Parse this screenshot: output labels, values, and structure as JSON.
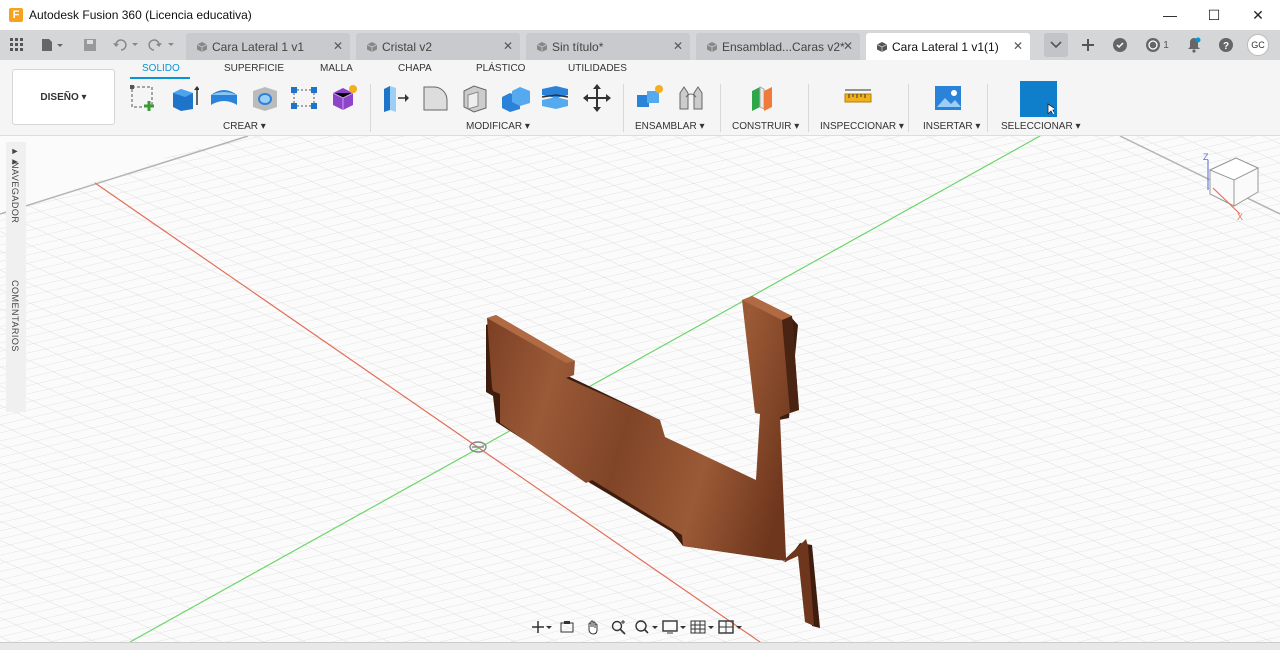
{
  "app": {
    "title": "Autodesk Fusion 360 (Licencia educativa)",
    "logo": "F"
  },
  "window": {
    "minimize": "—",
    "maximize": "☐",
    "close": "✕"
  },
  "tabs": [
    {
      "label": "Cara Lateral 1 v1",
      "active": false
    },
    {
      "label": "Cristal v2",
      "active": false
    },
    {
      "label": "Sin título*",
      "active": false
    },
    {
      "label": "Ensamblad...Caras v2*",
      "active": false
    },
    {
      "label": "Cara Lateral 1 v1(1)",
      "active": true
    }
  ],
  "topright": {
    "jobs_count": "1",
    "avatar": "GC"
  },
  "workspace": {
    "label": "DISEÑO ▾"
  },
  "workspace_tabs": [
    "SOLIDO",
    "SUPERFICIE",
    "MALLA",
    "CHAPA",
    "PLÁSTICO",
    "UTILIDADES"
  ],
  "groups": [
    "CREAR ▾",
    "MODIFICAR ▾",
    "ENSAMBLAR ▾",
    "CONSTRUIR ▾",
    "INSPECCIONAR ▾",
    "INSERTAR ▾",
    "SELECCIONAR ▾"
  ],
  "side": {
    "navegador": "NAVEGADOR",
    "comentarios": "COMENTARIOS"
  },
  "viewcube": {
    "z": "Z",
    "x": "X"
  },
  "colors": {
    "accent": "#0696d7",
    "wood": "#8a4a2a",
    "x_axis": "#e0705a",
    "y_axis": "#6dd56d"
  }
}
